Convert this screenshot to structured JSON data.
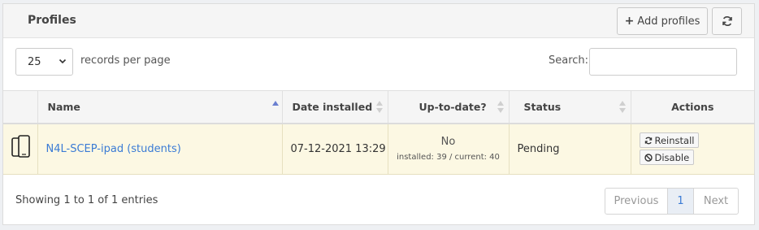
{
  "panel": {
    "title": "Profiles",
    "add_label": "Add profiles"
  },
  "controls": {
    "length_value": "25",
    "length_label": "records per page",
    "search_label": "Search:",
    "search_value": ""
  },
  "table": {
    "headers": [
      "",
      "Name",
      "Date installed",
      "Up-to-date?",
      "Status",
      "Actions"
    ],
    "sort_column": "Name",
    "rows": [
      {
        "device_icon": "mobile-device-icon",
        "name": "N4L-SCEP-ipad (students)",
        "date": "07-12-2021 13:29",
        "uptodate": "No",
        "uptodate_detail": "installed: 39 / current: 40",
        "status": "Pending",
        "reinstall_label": "Reinstall",
        "disable_label": "Disable"
      }
    ]
  },
  "footer": {
    "info": "Showing 1 to 1 of 1 entries",
    "prev_label": "Previous",
    "page": "1",
    "next_label": "Next"
  },
  "colors": {
    "row_highlight": "#fcf8e3",
    "link": "#3a7bd5",
    "sort_active": "#6a7fd0"
  }
}
